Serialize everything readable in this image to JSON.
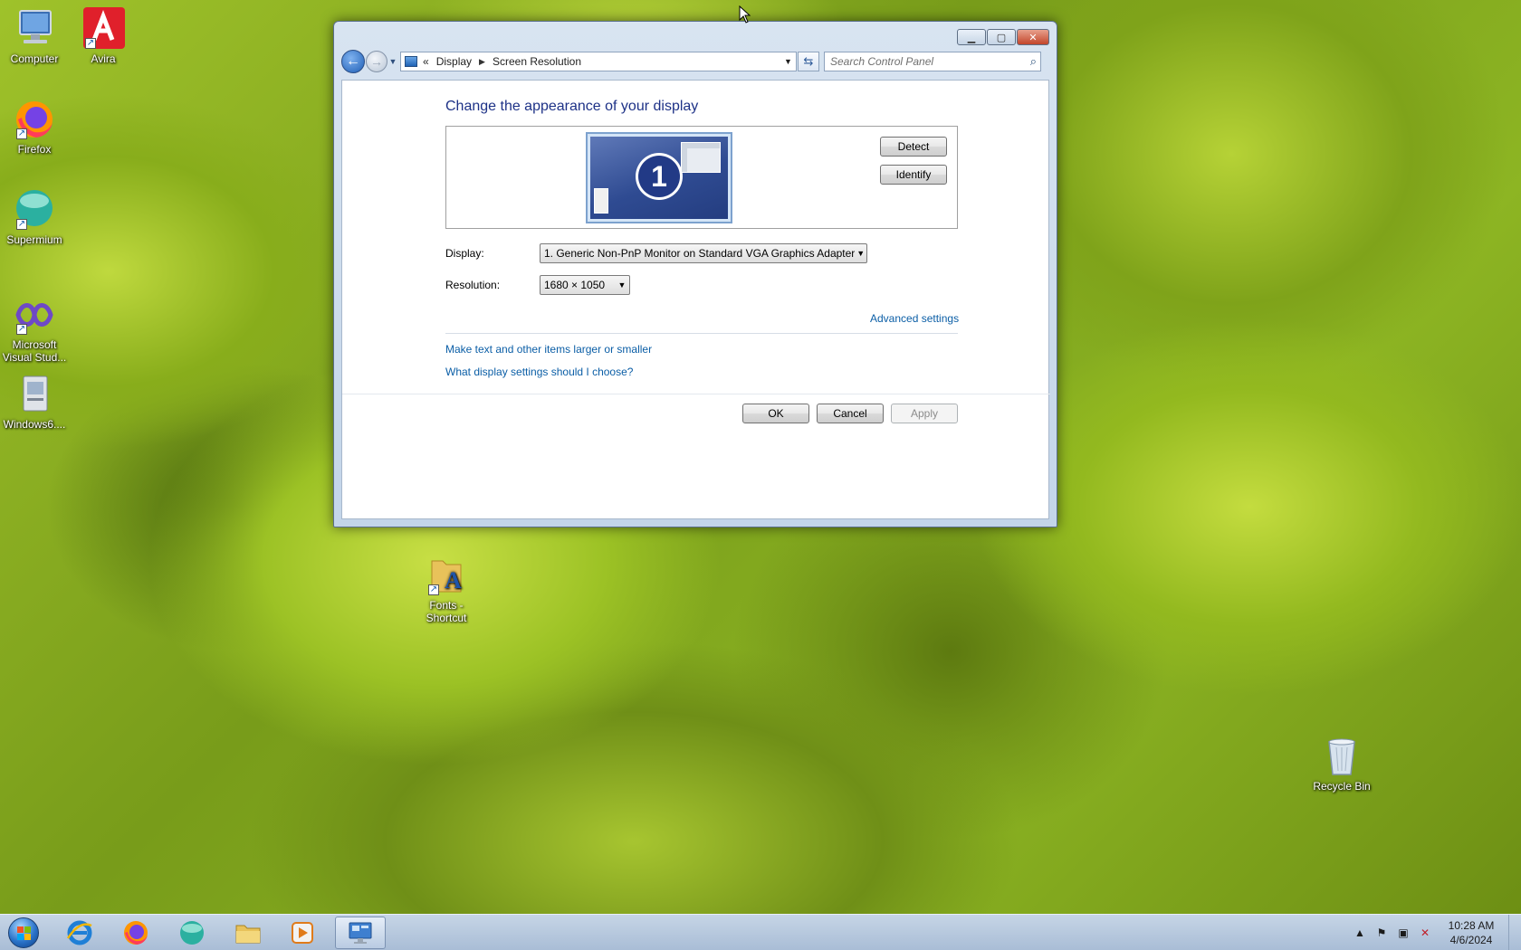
{
  "desktop": {
    "icons": [
      {
        "label": "Computer",
        "icon": "computer-icon"
      },
      {
        "label": "Avira",
        "icon": "avira-icon"
      },
      {
        "label": "Firefox",
        "icon": "firefox-icon"
      },
      {
        "label": "Supermium",
        "icon": "supermium-icon"
      },
      {
        "label": "Microsoft Visual Stud...",
        "icon": "visual-studio-icon"
      },
      {
        "label": "Windows6....",
        "icon": "installer-icon"
      },
      {
        "label": "Fonts - Shortcut",
        "icon": "fonts-folder-icon"
      },
      {
        "label": "Recycle Bin",
        "icon": "recycle-bin-icon"
      }
    ]
  },
  "window": {
    "address": {
      "overflow": "«",
      "crumbs": [
        "Display",
        "Screen Resolution"
      ]
    },
    "search": {
      "placeholder": "Search Control Panel"
    },
    "heading": "Change the appearance of your display",
    "monitor_number": "1",
    "detect_label": "Detect",
    "identify_label": "Identify",
    "display_label": "Display:",
    "display_value": "1. Generic Non-PnP Monitor on Standard VGA Graphics Adapter",
    "resolution_label": "Resolution:",
    "resolution_value": "1680 × 1050",
    "advanced_link": "Advanced settings",
    "links": [
      "Make text and other items larger or smaller",
      "What display settings should I choose?"
    ],
    "ok_label": "OK",
    "cancel_label": "Cancel",
    "apply_label": "Apply"
  },
  "taskbar": {
    "pinned": [
      "internet-explorer-icon",
      "firefox-icon",
      "supermium-icon",
      "explorer-icon",
      "media-player-icon",
      "control-panel-icon"
    ],
    "clock": {
      "time": "10:28 AM",
      "date": "4/6/2024"
    }
  },
  "colors": {
    "accent": "#1e3287",
    "link": "#0b5ea6",
    "taskbar": "#b8c9de"
  }
}
